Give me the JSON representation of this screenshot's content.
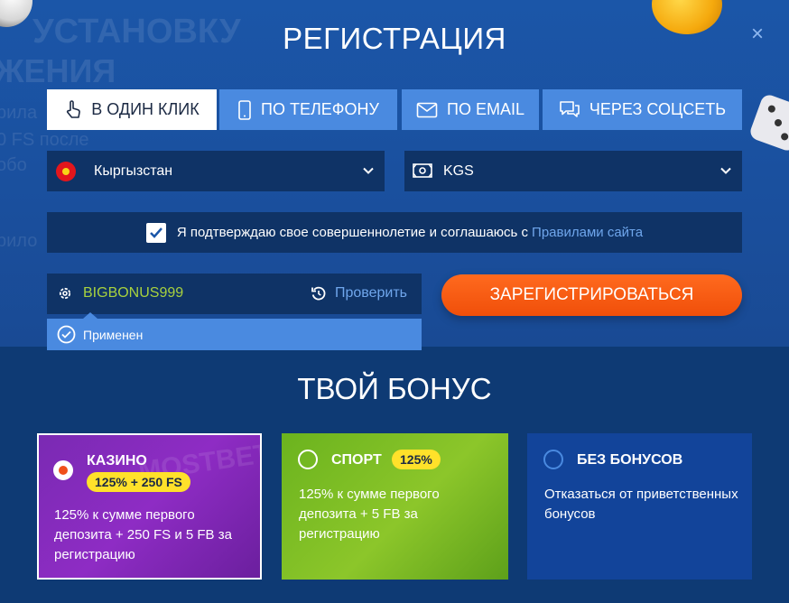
{
  "modal": {
    "title": "РЕГИСТРАЦИЯ",
    "close_label": "×"
  },
  "background_text": [
    "УСТАНОВКУ",
    "ЖЕНИЯ",
    "рила",
    "0 FS после",
    "обо",
    "рило"
  ],
  "tabs": [
    {
      "label": "В ОДИН КЛИК",
      "icon": "hand-pointer-icon",
      "active": true
    },
    {
      "label": "ПО ТЕЛЕФОНУ",
      "icon": "phone-icon",
      "active": false
    },
    {
      "label": "ПО EMAIL",
      "icon": "envelope-icon",
      "active": false
    },
    {
      "label": "ЧЕРЕЗ СОЦСЕТЬ",
      "icon": "chat-icon",
      "active": false
    }
  ],
  "country": {
    "value": "Кыргызстан",
    "icon": "kyrgyzstan-flag-icon"
  },
  "currency": {
    "value": "KGS",
    "icon": "banknote-icon"
  },
  "agreement": {
    "text": "Я подтверждаю свое совершеннолетие и соглашаюсь с",
    "link": "Правилами сайта",
    "checked": true
  },
  "promo": {
    "code": "BIGBONUS999",
    "check_label": "Проверить",
    "applied_label": "Применен"
  },
  "register_button": "ЗАРЕГИСТРИРОВАТЬСЯ",
  "bonus": {
    "title": "ТВОЙ БОНУС",
    "cards": [
      {
        "name": "КАЗИНО",
        "badge": "125% + 250 FS",
        "description": "125% к сумме первого депозита + 250 FS и 5 FB за регистрацию",
        "selected": true,
        "deco": "MOSTBET"
      },
      {
        "name": "СПОРТ",
        "badge": "125%",
        "description": "125% к сумме первого депозита + 5 FB за регистрацию",
        "selected": false
      },
      {
        "name": "БЕЗ БОНУСОВ",
        "badge": "",
        "description": "Отказаться от приветственных бонусов",
        "selected": false
      }
    ]
  },
  "colors": {
    "accent_blue": "#4a8ae0",
    "dark_field": "#0f3366",
    "register_orange": "#f5581a",
    "promo_green": "#a8d23e",
    "badge_yellow": "#ffe12a",
    "link_blue": "#6fa6ec"
  }
}
